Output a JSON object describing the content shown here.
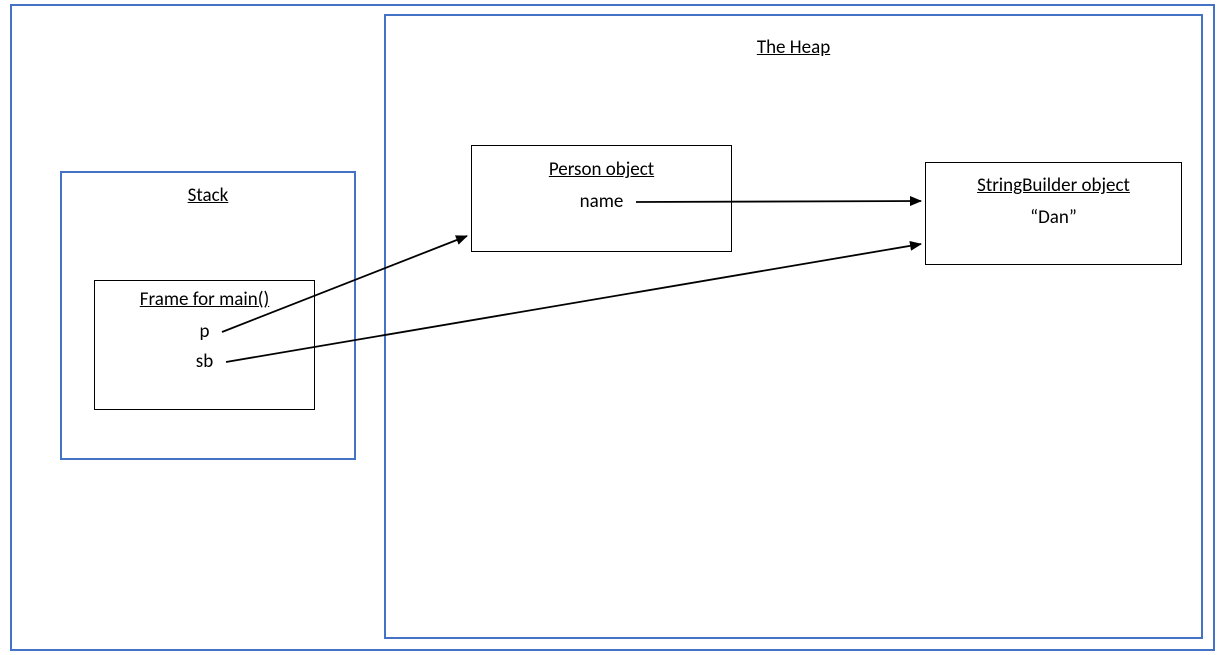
{
  "stack": {
    "title": "Stack",
    "frame": {
      "title": "Frame for main()",
      "vars": {
        "p": "p",
        "sb": "sb"
      }
    }
  },
  "heap": {
    "title": "The Heap",
    "person": {
      "title": "Person object",
      "field": "name"
    },
    "stringbuilder": {
      "title": "StringBuilder object",
      "value": "“Dan”"
    }
  },
  "arrows": [
    {
      "from": "stack.frame.p",
      "to": "heap.person"
    },
    {
      "from": "stack.frame.sb",
      "to": "heap.stringbuilder"
    },
    {
      "from": "heap.person.name",
      "to": "heap.stringbuilder"
    }
  ]
}
